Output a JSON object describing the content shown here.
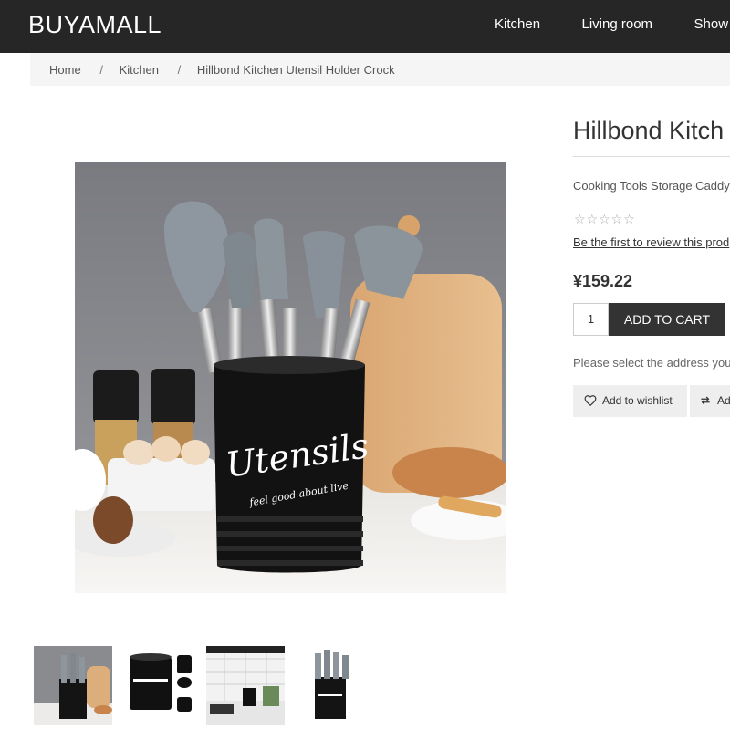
{
  "header": {
    "logo": "BUYAMALL",
    "nav": [
      {
        "label": "Kitchen"
      },
      {
        "label": "Living room"
      },
      {
        "label": "Show"
      }
    ]
  },
  "breadcrumb": {
    "items": [
      "Home",
      "Kitchen",
      "Hillbond Kitchen Utensil Holder Crock"
    ],
    "separator": "/"
  },
  "product": {
    "title": "Hillbond Kitch",
    "subtitle": "Cooking Tools Storage Caddy,",
    "rating_stars": "☆☆☆☆☆",
    "rating_value": 0,
    "review_link": "Be the first to review this prod",
    "price": "¥159.22",
    "quantity": "1",
    "add_to_cart": "ADD TO CART",
    "address_note": "Please select the address you",
    "wishlist_label": "Add to wishlist",
    "compare_label": "Ad"
  },
  "image": {
    "main_text": "Utensils",
    "main_tagline": "feel good about live",
    "thumb_count": 4
  },
  "colors": {
    "header_bg": "#262626",
    "breadcrumb_bg": "#f5f5f5",
    "button_dark": "#333333",
    "button_light": "#eeeeee"
  }
}
